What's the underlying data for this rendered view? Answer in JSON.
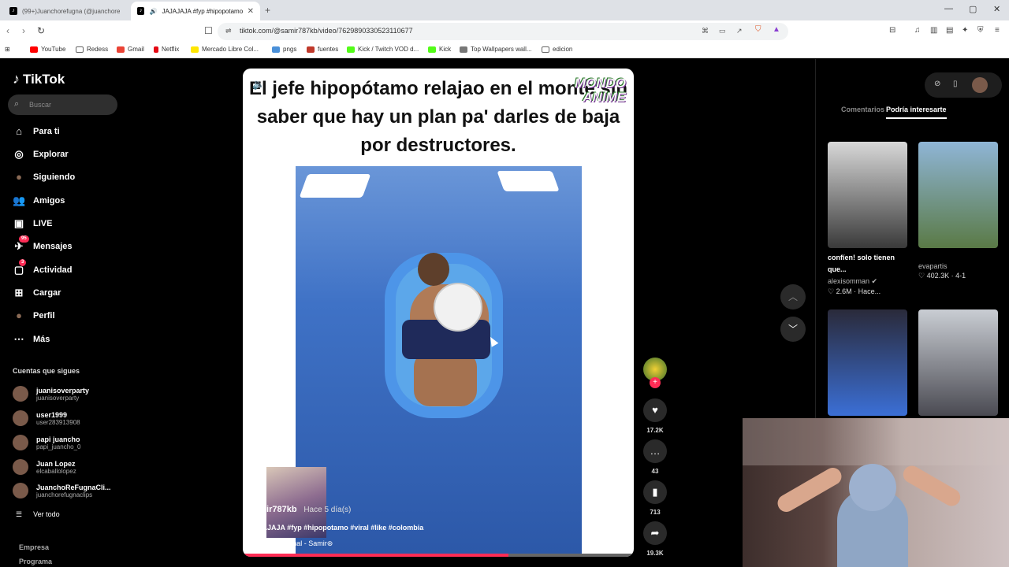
{
  "browser": {
    "tabs": [
      {
        "title": "(99+)Juanchorefugna (@juanchoref..."
      },
      {
        "title": "JAJAJAJA #fyp #hipopotamo"
      }
    ],
    "new_tab": "+",
    "url": "tiktok.com/@samir787kb/video/7629890330523110677",
    "window_controls": {
      "minimize": "—",
      "maximize": "▢",
      "close": "✕"
    },
    "bookmarks": [
      {
        "label": "YouTube",
        "color": "#ff0000"
      },
      {
        "label": "Redess",
        "color": "#888888"
      },
      {
        "label": "Gmail",
        "color": "#ea4335"
      },
      {
        "label": "Netflix",
        "color": "#e50914"
      },
      {
        "label": "Mercado Libre Col...",
        "color": "#ffe600"
      },
      {
        "label": "pngs",
        "color": "#4a90d9"
      },
      {
        "label": "fuentes",
        "color": "#c0392b"
      },
      {
        "label": "Kick / Twitch VOD d...",
        "color": "#53fc18"
      },
      {
        "label": "Kick",
        "color": "#53fc18"
      },
      {
        "label": "Top Wallpapers wall...",
        "color": "#777777"
      },
      {
        "label": "edicion",
        "color": "#888888"
      }
    ]
  },
  "sidebar": {
    "logo": "TikTok",
    "search_placeholder": "Buscar",
    "items": [
      {
        "label": "Para ti",
        "icon": "home-icon",
        "glyph": "⌂"
      },
      {
        "label": "Explorar",
        "icon": "compass-icon",
        "glyph": "◎"
      },
      {
        "label": "Siguiendo",
        "icon": "following-avatar-icon",
        "glyph": "●"
      },
      {
        "label": "Amigos",
        "icon": "friends-icon",
        "glyph": "👥"
      },
      {
        "label": "LIVE",
        "icon": "live-icon",
        "glyph": "▣"
      },
      {
        "label": "Mensajes",
        "icon": "messages-icon",
        "glyph": "✈",
        "badge": "95"
      },
      {
        "label": "Actividad",
        "icon": "activity-icon",
        "glyph": "▢",
        "badge": "3"
      },
      {
        "label": "Cargar",
        "icon": "upload-icon",
        "glyph": "⊞"
      },
      {
        "label": "Perfil",
        "icon": "profile-avatar-icon",
        "glyph": "●"
      },
      {
        "label": "Más",
        "icon": "more-icon",
        "glyph": "⋯"
      }
    ],
    "following_title": "Cuentas que sigues",
    "following": [
      {
        "name": "juanisoverparty",
        "handle": "juanisoverparty"
      },
      {
        "name": "user1999",
        "handle": "user283913908"
      },
      {
        "name": "papi juancho",
        "handle": "papi_juancho_0"
      },
      {
        "name": "Juan Lopez",
        "handle": "elcaballolopez"
      },
      {
        "name": "JuanchoReFugnaCli...",
        "handle": "juanchorefugnaclips"
      }
    ],
    "see_all": "Ver todo",
    "footer": [
      "Empresa",
      "Programa"
    ]
  },
  "video": {
    "caption": "El jefe hipopótamo relajao en el monte sin saber que hay un plan pa' darles de baja por destructores.",
    "watermark_line1": "MONDO",
    "watermark_line2": "ANIME",
    "user": "samir787kb",
    "when": "Hace 5 día(s)",
    "description": "JAJAJAJA #fyp #hipopotamo #viral #like #colombia",
    "sound": "♫  sonido original - Samir⊛",
    "progress": 0.68
  },
  "actions": {
    "likes": "17.2K",
    "comments": "43",
    "saves": "713",
    "shares": "19.3K"
  },
  "right_panel": {
    "tabs": [
      "Comentarios",
      "Podría interesarte"
    ],
    "active_tab": 1,
    "cards": [
      {
        "title": "confíen! solo tienen que...",
        "author": "alexisomman ✔",
        "stats": "♡ 2.6M · Hace...",
        "color_top": "#d8d8d8",
        "color_bottom": "#3a3a3a"
      },
      {
        "title": "",
        "author": "evapartis",
        "stats": "♡ 402.3K · 4-1",
        "color_top": "#8fb5d6",
        "color_bottom": "#5a7a46"
      },
      {
        "title": "",
        "author": "",
        "stats": "",
        "color_top": "#2a2a3a",
        "color_bottom": "#3b6fd6"
      },
      {
        "title": "",
        "author": "",
        "stats": "",
        "color_top": "#c9cdd3",
        "color_bottom": "#4a4a52"
      }
    ]
  }
}
